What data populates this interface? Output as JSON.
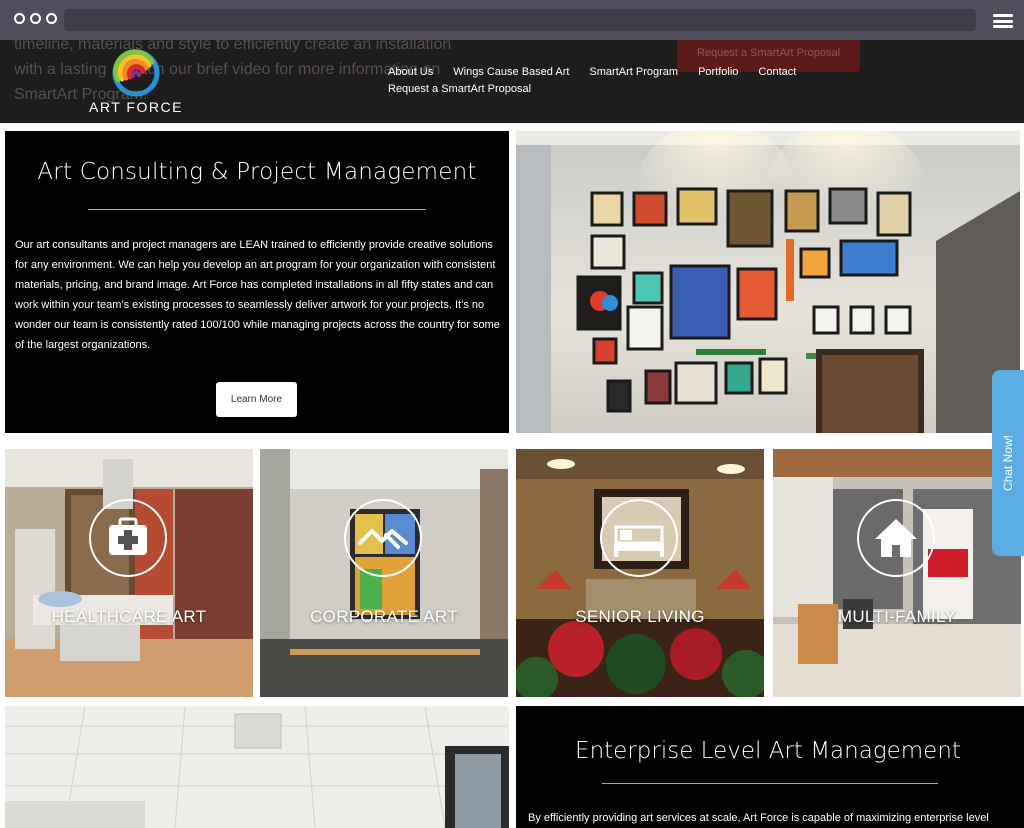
{
  "header": {
    "ghost_text": "timeline, materials and style to efficiently create an installation with a lasting       . Watch our brief video for more information on        SmartArt Program.",
    "ghost_button": "Request a SmartArt Proposal",
    "logo_text": "ART FORCE",
    "nav": {
      "about": "About Us",
      "wings": "Wings Cause Based Art",
      "smartart": "SmartArt Program",
      "portfolio": "Portfolio",
      "contact": "Contact",
      "request": "Request a SmartArt Proposal"
    }
  },
  "hero": {
    "title": "Art Consulting & Project Management",
    "body": "Our art consultants and project managers are LEAN trained to efficiently provide creative solutions for any environment. We can help you develop an art program for your organization with consistent materials, pricing, and brand image. Art Force has completed installations in all fifty states and can work within your team’s existing processes to seamlessly deliver artwork for your projects. It’s no wonder our team is consistently rated 100/100 while managing projects across the country for some of the largest organizations.",
    "button": "Learn More"
  },
  "tiles": {
    "healthcare": "HEALTHCARE ART",
    "corporate": "CORPORATE ART",
    "senior": "SENIOR LIVING",
    "multifamily": "MULTI-FAMILY"
  },
  "enterprise": {
    "title": "Enterprise Level Art Management",
    "body": "By efficiently providing art services at scale, Art Force is capable of maximizing enterprise level"
  },
  "chat": {
    "label": "Chat Now!"
  }
}
